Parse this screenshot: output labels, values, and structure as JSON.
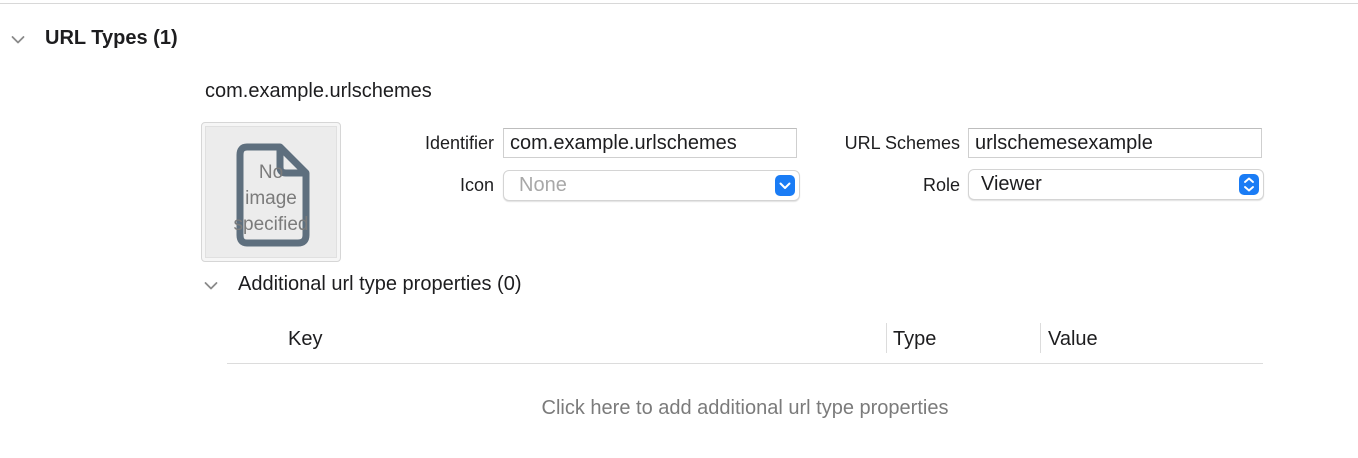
{
  "section": {
    "title": "URL Types (1)"
  },
  "url_type": {
    "name": "com.example.urlschemes",
    "image_well": {
      "line1": "No",
      "line2": "image",
      "line3": "specified"
    },
    "identifier": {
      "label": "Identifier",
      "value": "com.example.urlschemes"
    },
    "icon": {
      "label": "Icon",
      "placeholder": "None"
    },
    "url_schemes": {
      "label": "URL Schemes",
      "value": "urlschemesexample"
    },
    "role": {
      "label": "Role",
      "value": "Viewer"
    }
  },
  "additional": {
    "title": "Additional url type properties (0)",
    "columns": [
      "Key",
      "Type",
      "Value"
    ],
    "empty_hint": "Click here to add additional url type properties"
  },
  "colors": {
    "accent": "#1a7cf5",
    "icon_gray": "#5e6f7e"
  }
}
